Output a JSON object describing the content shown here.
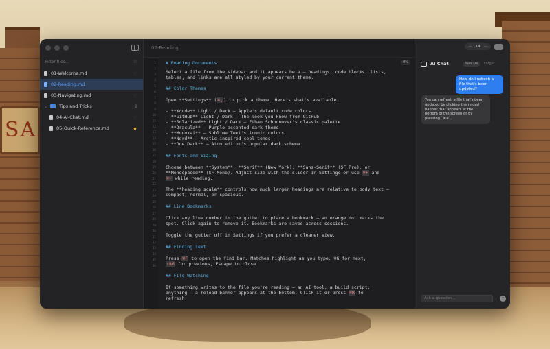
{
  "background": {
    "sign_text": "SAL"
  },
  "sidebar": {
    "filter_placeholder": "Filter files...",
    "items": [
      {
        "label": "01-Welcome.md",
        "type": "file",
        "favorite": false,
        "active": false
      },
      {
        "label": "02-Reading.md",
        "type": "file",
        "favorite": false,
        "active": true
      },
      {
        "label": "03-Navigating.md",
        "type": "file",
        "favorite": false,
        "active": false
      },
      {
        "label": "Tips and Tricks",
        "type": "folder",
        "count": "2"
      },
      {
        "label": "04-AI-Chat.md",
        "type": "file",
        "favorite": false,
        "active": false,
        "child": true
      },
      {
        "label": "05-Quick-Reference.md",
        "type": "file",
        "favorite": true,
        "active": false,
        "child": true
      }
    ]
  },
  "editor": {
    "title": "02-Reading",
    "progress_badge": "0%",
    "line_numbers": [
      "1",
      "2",
      "3",
      "4",
      "5",
      "6",
      "7",
      "8",
      "9",
      "10",
      "11",
      "12",
      "13",
      "14",
      "15",
      "16",
      "17",
      "18",
      "19",
      "20",
      "21",
      "22",
      "23",
      "24",
      "25",
      "26",
      "27",
      "28",
      "29",
      "30",
      "31",
      "32",
      "33",
      "34",
      "35",
      "36"
    ],
    "lines": [
      {
        "text": "# Reading Documents",
        "head": true
      },
      {
        "text": "Select a file from the sidebar and it appears here — headings, code blocks, lists,"
      },
      {
        "text": "tables, and links are all styled by your current theme."
      },
      {
        "text": "## Color Themes",
        "head": true
      },
      {
        "text_before": "Open **Settings** (",
        "code": "⌘,",
        "text_after": ") to pick a theme. Here's what's available:"
      },
      {
        "text": "- **Xcode** Light / Dark — Apple's default code colors"
      },
      {
        "text": "- **GitHub** Light / Dark — The look you know from GitHub"
      },
      {
        "text": "- **Solarized** Light / Dark — Ethan Schoonover's classic palette"
      },
      {
        "text": "- **Dracula** — Purple-accented dark theme"
      },
      {
        "text": "- **Monokai** — Sublime Text's iconic colors"
      },
      {
        "text": "- **Nord** — Arctic-inspired cool tones"
      },
      {
        "text": "- **One Dark** — Atom editor's popular dark scheme"
      },
      {
        "text": "## Fonts and Sizing",
        "head": true
      },
      {
        "text": "Choose between **System**, **Serif** (New York), **Sans-Serif** (SF Pro), or"
      },
      {
        "text_before": "**Monospaced** (SF Mono). Adjust size with the slider in Settings or use ",
        "code": "⌘+",
        "text_after": " and"
      },
      {
        "text_before": "",
        "code": "⌘−",
        "text_after": " while reading."
      },
      {
        "text": "The **heading scale** controls how much larger headings are relative to body text —"
      },
      {
        "text": "compact, normal, or spacious."
      },
      {
        "text": "## Line Bookmarks",
        "head": true
      },
      {
        "text": "Click any line number in the gutter to place a bookmark — an orange dot marks the"
      },
      {
        "text": "spot. Click again to remove it. Bookmarks are saved across sessions."
      },
      {
        "text": "Toggle the gutter off in Settings if you prefer a cleaner view."
      },
      {
        "text": "## Finding Text",
        "head": true
      },
      {
        "text_before": "Press ",
        "code": "⌘F",
        "text_after": " to open the find bar. Matches highlight as you type. ⌘G for next,"
      },
      {
        "text_before": "",
        "code": "⇧⌘G",
        "text_after": " for previous, Escape to close."
      },
      {
        "text": "## File Watching",
        "head": true
      },
      {
        "text": "If something writes to the file you're reading — an AI tool, a build script,"
      },
      {
        "text_before": "anything — a reload banner appears at the bottom. Click it or press ",
        "code": "⌘R",
        "text_after": " to"
      },
      {
        "text": "refresh."
      }
    ]
  },
  "chat": {
    "font_size_value": "14",
    "title": "AI Chat",
    "turn_badge": "Turn 1/3",
    "forget_label": "Forget",
    "user_message": "How do I refresh a file that's been updated?",
    "ai_message": "You can refresh a file that's been updated by clicking the reload banner that appears at the bottom of the screen or by pressing `⌘R`.",
    "input_placeholder": "Ask a question...",
    "send_icon": "↑"
  }
}
